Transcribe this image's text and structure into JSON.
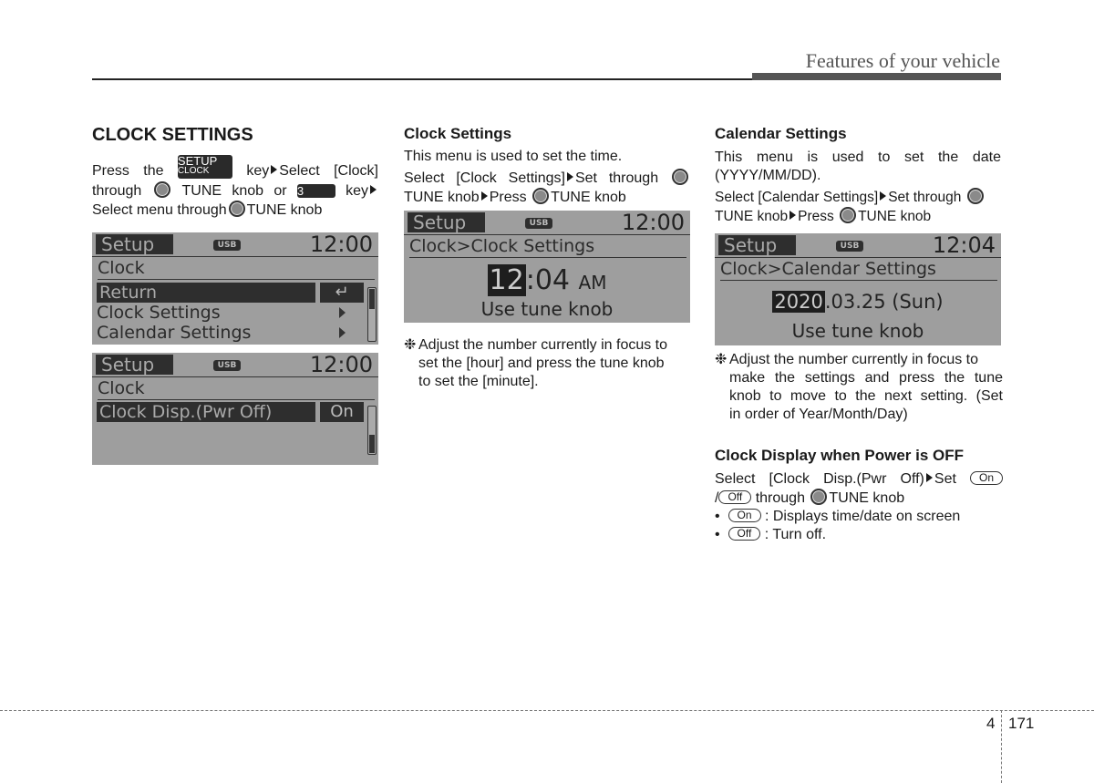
{
  "header": {
    "title": "Features of your vehicle"
  },
  "col1": {
    "heading": "CLOCK SETTINGS",
    "line1_a": "Press the",
    "setup_key_top": "SETUP",
    "setup_key_bottom": "CLOCK",
    "line1_b": "key",
    "line1_c": "Select [Clock]",
    "line2_a": "through",
    "line2_b": "TUNE knob or",
    "num_key": "3",
    "line2_c": "key",
    "line3_a": "Select menu through",
    "line3_b": "TUNE knob",
    "screen1": {
      "setup": "Setup",
      "usb": "USB",
      "time": "12:00",
      "sub": "Clock",
      "rows": [
        {
          "label": "Return",
          "right": "↵"
        },
        {
          "label": "Clock Settings"
        },
        {
          "label": "Calendar Settings"
        }
      ]
    },
    "screen2": {
      "setup": "Setup",
      "usb": "USB",
      "time": "12:00",
      "sub": "Clock",
      "row_label": "Clock Disp.(Pwr Off)",
      "row_value": "On"
    }
  },
  "col2": {
    "heading": "Clock Settings",
    "desc": "This menu is used to set the time.",
    "inst1_a": "Select [Clock Settings]",
    "inst1_b": "Set through",
    "inst2_a": "TUNE knob",
    "inst2_b": "Press",
    "inst2_c": "TUNE knob",
    "screen": {
      "setup": "Setup",
      "usb": "USB",
      "time": "12:00",
      "sub": "Clock>Clock Settings",
      "hour": "12",
      "sep": ":",
      "minute": "04",
      "ampm": "AM",
      "hint": "Use tune knob"
    },
    "note_mark": "❉",
    "note": [
      "Adjust the number currently in focus to",
      "set the [hour] and press the tune knob",
      "to set the [minute]."
    ]
  },
  "col3": {
    "heading": "Calendar Settings",
    "desc1": "This menu is used to set the date",
    "desc2": "(YYYY/MM/DD).",
    "inst1_a": "Select [Calendar Settings]",
    "inst1_b": "Set through",
    "inst2_a": "TUNE knob",
    "inst2_b": "Press",
    "inst2_c": "TUNE knob",
    "screen": {
      "setup": "Setup",
      "usb": "USB",
      "time": "12:04",
      "sub": "Clock>Calendar Settings",
      "year": "2020",
      "rest": ".03.25 (Sun)",
      "hint": "Use tune knob"
    },
    "note_mark": "❉",
    "note": [
      "Adjust the number currently in focus to",
      "make the settings and press the tune",
      "knob to move to the next setting. (Set",
      "in order of Year/Month/Day)"
    ],
    "heading2": "Clock Display when Power is OFF",
    "pwr1_a": "Select [Clock Disp.(Pwr Off)",
    "pwr1_b": "Set",
    "pill_on": "On",
    "pill_off": "Off",
    "pwr2_a": "/",
    "pwr2_b": "through",
    "pwr2_c": "TUNE knob",
    "bullets": [
      {
        "pill": "On",
        "text": ": Displays time/date on screen"
      },
      {
        "pill": "Off",
        "text": ": Turn off."
      }
    ]
  },
  "footer": {
    "chapter": "4",
    "page": "171"
  }
}
